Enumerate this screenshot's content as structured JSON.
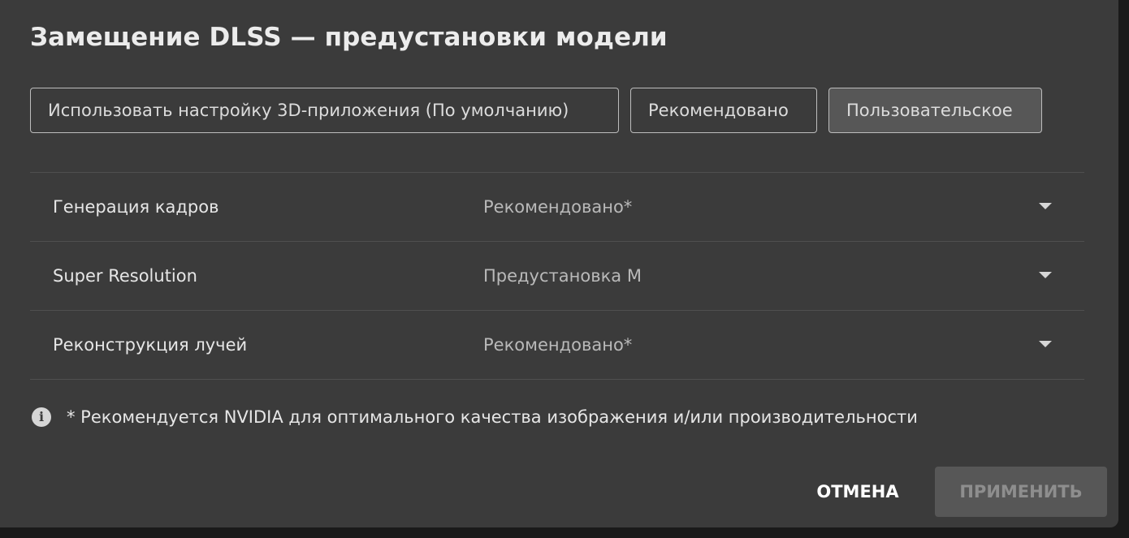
{
  "dialog": {
    "title": "Замещение DLSS — предустановки модели"
  },
  "presets": [
    {
      "label": "Использовать настройку 3D-приложения (По умолчанию)",
      "selected": false
    },
    {
      "label": "Рекомендовано",
      "selected": false
    },
    {
      "label": "Пользовательское",
      "selected": true
    }
  ],
  "settings": [
    {
      "label": "Генерация кадров",
      "value": "Рекомендовано*"
    },
    {
      "label": "Super Resolution",
      "value": "Предустановка M"
    },
    {
      "label": "Реконструкция лучей",
      "value": "Рекомендовано*"
    }
  ],
  "note": {
    "icon": "info-icon",
    "text": "* Рекомендуется NVIDIA для оптимального качества изображения и/или производительности"
  },
  "actions": {
    "cancel_label": "ОТМЕНА",
    "apply_label": "ПРИМЕНИТЬ",
    "apply_enabled": false
  },
  "colors": {
    "background": "#3b3b3b",
    "selected_preset": "#575757",
    "divider": "#4f4f4f"
  }
}
